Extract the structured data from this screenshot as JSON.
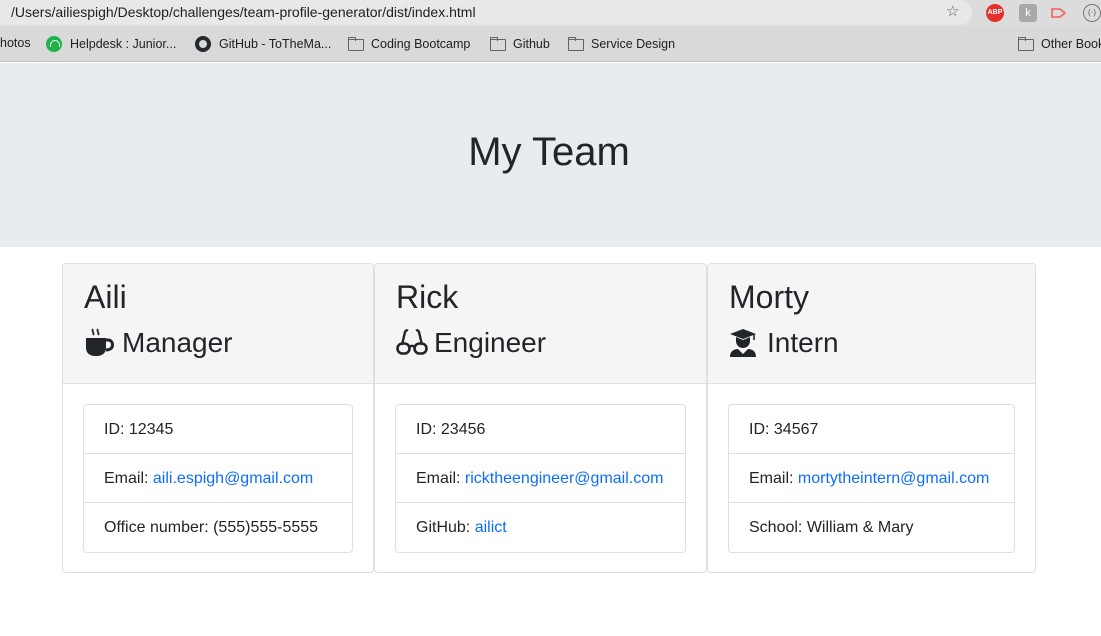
{
  "browser": {
    "url": "/Users/ailiespigh/Desktop/challenges/team-profile-generator/dist/index.html",
    "extensions": {
      "abp": "ABP",
      "k": "k",
      "circle": "(·)"
    },
    "bookmarks": [
      {
        "label": "hotos",
        "icon": "none"
      },
      {
        "label": "Helpdesk : Junior...",
        "icon": "helpdesk-icon"
      },
      {
        "label": "GitHub - ToTheMa...",
        "icon": "github-icon"
      },
      {
        "label": "Coding Bootcamp",
        "icon": "folder-icon"
      },
      {
        "label": "Github",
        "icon": "folder-icon"
      },
      {
        "label": "Service Design",
        "icon": "folder-icon"
      },
      {
        "label": "Other Bookmarks",
        "icon": "folder-icon"
      }
    ]
  },
  "page": {
    "title": "My Team"
  },
  "team": [
    {
      "name": "Aili",
      "role": "Manager",
      "icon": "coffee-mug-icon",
      "id_label": "ID: ",
      "id": "12345",
      "email_label": "Email: ",
      "email": "aili.espigh@gmail.com",
      "extra_label": "Office number: ",
      "extra": "(555)555-5555"
    },
    {
      "name": "Rick",
      "role": "Engineer",
      "icon": "glasses-icon",
      "id_label": "ID: ",
      "id": "23456",
      "email_label": "Email: ",
      "email": "ricktheengineer@gmail.com",
      "extra_label": "GitHub: ",
      "extra": "ailict"
    },
    {
      "name": "Morty",
      "role": "Intern",
      "icon": "graduate-icon",
      "id_label": "ID: ",
      "id": "34567",
      "email_label": "Email: ",
      "email": "mortytheintern@gmail.com",
      "extra_label": "School: ",
      "extra": "William & Mary"
    }
  ],
  "colors": {
    "jumbotron": "#e9ecef",
    "link": "#0d6efd",
    "header": "#f5f5f5"
  }
}
